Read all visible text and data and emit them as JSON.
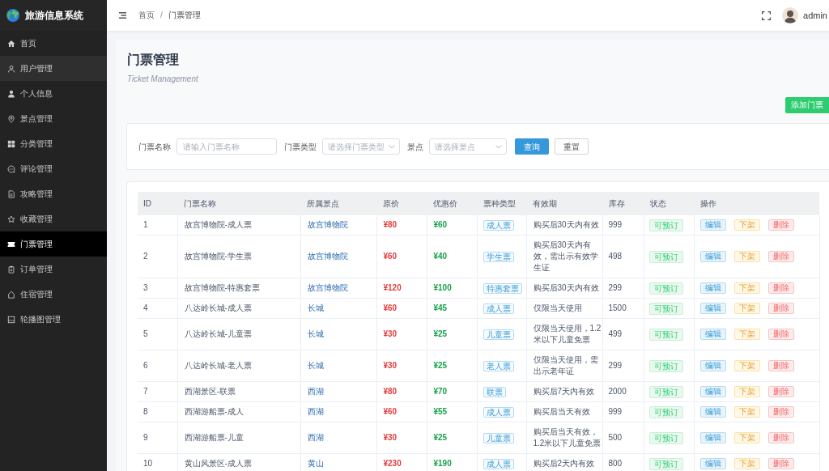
{
  "sidebar": {
    "title": "旅游信息系统",
    "items": [
      {
        "label": "首页",
        "selected": false,
        "hovered": false
      },
      {
        "label": "用户管理",
        "selected": false,
        "hovered": true
      },
      {
        "label": "个人信息",
        "selected": false,
        "hovered": false
      },
      {
        "label": "景点管理",
        "selected": false,
        "hovered": false
      },
      {
        "label": "分类管理",
        "selected": false,
        "hovered": false
      },
      {
        "label": "评论管理",
        "selected": false,
        "hovered": false
      },
      {
        "label": "攻略管理",
        "selected": false,
        "hovered": false
      },
      {
        "label": "收藏管理",
        "selected": false,
        "hovered": false
      },
      {
        "label": "门票管理",
        "selected": true,
        "hovered": false
      },
      {
        "label": "订单管理",
        "selected": false,
        "hovered": false
      },
      {
        "label": "住宿管理",
        "selected": false,
        "hovered": false
      },
      {
        "label": "轮播图管理",
        "selected": false,
        "hovered": false
      }
    ]
  },
  "header": {
    "breadcrumb": [
      {
        "label": "首页"
      },
      {
        "label": "门票管理"
      }
    ],
    "separator": "/",
    "user": "admin"
  },
  "page": {
    "title": "门票管理",
    "subtitle": "Ticket Management",
    "add_button": "添加门票"
  },
  "filters": [
    {
      "kind": "input",
      "label": "门票名称",
      "placeholder": "请输入门票名称"
    },
    {
      "kind": "select",
      "label": "门票类型",
      "placeholder": "请选择门票类型"
    },
    {
      "kind": "select",
      "label": "景点",
      "placeholder": "请选择景点"
    }
  ],
  "filter_buttons": [
    {
      "kind": "primary",
      "label": "查询"
    },
    {
      "kind": "default",
      "label": "重置"
    }
  ],
  "table": {
    "columns": [
      "ID",
      "门票名称",
      "所属景点",
      "原价",
      "优惠价",
      "票种类型",
      "有效期",
      "库存",
      "状态",
      "操作"
    ],
    "rows": [
      {
        "id": "1",
        "name": "故宫博物院-成人票",
        "attraction": "故宫博物院",
        "price": "¥80",
        "discount_price": "¥60",
        "type": "成人票",
        "validity": "购买后30天内有效",
        "stock": "999",
        "status": "可预订",
        "actions": [
          {
            "kind": "edit",
            "label": "编辑"
          },
          {
            "kind": "unlist",
            "label": "下架"
          },
          {
            "kind": "delete",
            "label": "删除"
          }
        ]
      },
      {
        "id": "2",
        "name": "故宫博物院-学生票",
        "attraction": "故宫博物院",
        "price": "¥60",
        "discount_price": "¥40",
        "type": "学生票",
        "validity": "购买后30天内有效，需出示有效学生证",
        "stock": "498",
        "status": "可预订",
        "actions": [
          {
            "kind": "edit",
            "label": "编辑"
          },
          {
            "kind": "unlist",
            "label": "下架"
          },
          {
            "kind": "delete",
            "label": "删除"
          }
        ]
      },
      {
        "id": "3",
        "name": "故宫博物院-特惠套票",
        "attraction": "故宫博物院",
        "price": "¥120",
        "discount_price": "¥100",
        "type": "特惠套票",
        "validity": "购买后30天内有效",
        "stock": "299",
        "status": "可预订",
        "actions": [
          {
            "kind": "edit",
            "label": "编辑"
          },
          {
            "kind": "unlist",
            "label": "下架"
          },
          {
            "kind": "delete",
            "label": "删除"
          }
        ]
      },
      {
        "id": "4",
        "name": "八达岭长城-成人票",
        "attraction": "长城",
        "price": "¥60",
        "discount_price": "¥45",
        "type": "成人票",
        "validity": "仅限当天使用",
        "stock": "1500",
        "status": "可预订",
        "actions": [
          {
            "kind": "edit",
            "label": "编辑"
          },
          {
            "kind": "unlist",
            "label": "下架"
          },
          {
            "kind": "delete",
            "label": "删除"
          }
        ]
      },
      {
        "id": "5",
        "name": "八达岭长城-儿童票",
        "attraction": "长城",
        "price": "¥30",
        "discount_price": "¥25",
        "type": "儿童票",
        "validity": "仅限当天使用，1.2米以下儿童免票",
        "stock": "499",
        "status": "可预订",
        "actions": [
          {
            "kind": "edit",
            "label": "编辑"
          },
          {
            "kind": "unlist",
            "label": "下架"
          },
          {
            "kind": "delete",
            "label": "删除"
          }
        ]
      },
      {
        "id": "6",
        "name": "八达岭长城-老人票",
        "attraction": "长城",
        "price": "¥30",
        "discount_price": "¥25",
        "type": "老人票",
        "validity": "仅限当天使用，需出示老年证",
        "stock": "299",
        "status": "可预订",
        "actions": [
          {
            "kind": "edit",
            "label": "编辑"
          },
          {
            "kind": "unlist",
            "label": "下架"
          },
          {
            "kind": "delete",
            "label": "删除"
          }
        ]
      },
      {
        "id": "7",
        "name": "西湖景区-联票",
        "attraction": "西湖",
        "price": "¥80",
        "discount_price": "¥70",
        "type": "联票",
        "validity": "购买后7天内有效",
        "stock": "2000",
        "status": "可预订",
        "actions": [
          {
            "kind": "edit",
            "label": "编辑"
          },
          {
            "kind": "unlist",
            "label": "下架"
          },
          {
            "kind": "delete",
            "label": "删除"
          }
        ]
      },
      {
        "id": "8",
        "name": "西湖游船票-成人",
        "attraction": "西湖",
        "price": "¥60",
        "discount_price": "¥55",
        "type": "成人票",
        "validity": "购买后当天有效",
        "stock": "999",
        "status": "可预订",
        "actions": [
          {
            "kind": "edit",
            "label": "编辑"
          },
          {
            "kind": "unlist",
            "label": "下架"
          },
          {
            "kind": "delete",
            "label": "删除"
          }
        ]
      },
      {
        "id": "9",
        "name": "西湖游船票-儿童",
        "attraction": "西湖",
        "price": "¥30",
        "discount_price": "¥25",
        "type": "儿童票",
        "validity": "购买后当天有效，1.2米以下儿童免票",
        "stock": "500",
        "status": "可预订",
        "actions": [
          {
            "kind": "edit",
            "label": "编辑"
          },
          {
            "kind": "unlist",
            "label": "下架"
          },
          {
            "kind": "delete",
            "label": "删除"
          }
        ]
      },
      {
        "id": "10",
        "name": "黄山风景区-成人票",
        "attraction": "黄山",
        "price": "¥230",
        "discount_price": "¥190",
        "type": "成人票",
        "validity": "购买后2天内有效",
        "stock": "800",
        "status": "可预订",
        "actions": [
          {
            "kind": "edit",
            "label": "编辑"
          },
          {
            "kind": "unlist",
            "label": "下架"
          },
          {
            "kind": "delete",
            "label": "删除"
          }
        ]
      }
    ]
  }
}
